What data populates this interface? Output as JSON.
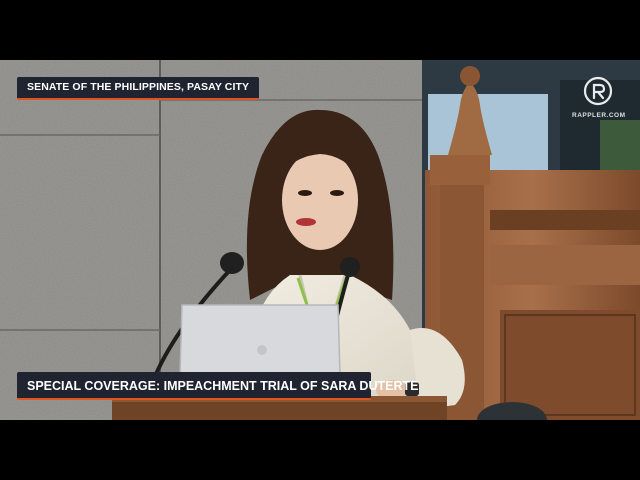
{
  "overlay": {
    "location": "SENATE OF THE PHILIPPINES, PASAY CITY",
    "coverage": "SPECIAL COVERAGE: IMPEACHMENT TRIAL OF SARA DUTERTE"
  },
  "brand": {
    "name": "RAPPLER.COM",
    "logo_icon": "rappler-logo-icon"
  },
  "colors": {
    "overlay_bg": "#1f2430",
    "accent": "#e2541c"
  }
}
